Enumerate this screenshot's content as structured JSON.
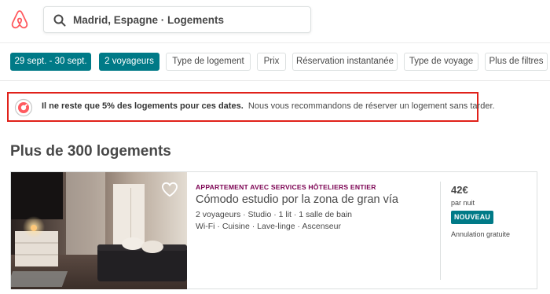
{
  "header": {
    "logo": "airbnb-logo",
    "search_value": "Madrid, Espagne · Logements"
  },
  "filters": [
    {
      "label": "29 sept. - 30 sept.",
      "active": true
    },
    {
      "label": "2 voyageurs",
      "active": true
    },
    {
      "label": "Type de logement",
      "active": false
    },
    {
      "label": "Prix",
      "active": false
    },
    {
      "label": "Réservation instantanée",
      "active": false
    },
    {
      "label": "Type de voyage",
      "active": false
    },
    {
      "label": "Plus de filtres",
      "active": false
    }
  ],
  "alert": {
    "strong": "Il ne reste que 5% des logements pour ces dates.",
    "text": "Nous vous recommandons de réserver un logement sans tarder."
  },
  "results": {
    "heading": "Plus de 300 logements"
  },
  "listing": {
    "kicker": "APPARTEMENT AVEC SERVICES HÔTELIERS ENTIER",
    "title": "Cómodo estudio por la zona de gran vía",
    "details": "2 voyageurs · Studio · 1 lit · 1 salle de bain",
    "amenities": "Wi-Fi · Cuisine · Lave-linge · Ascenseur",
    "price": "42€",
    "per_night": "par nuit",
    "badge": "NOUVEAU",
    "cancellation": "Annulation gratuite"
  },
  "colors": {
    "brand": "#ff5a5f",
    "teal": "#007a87",
    "alert_border": "#e0211a",
    "kicker": "#7b0051"
  }
}
